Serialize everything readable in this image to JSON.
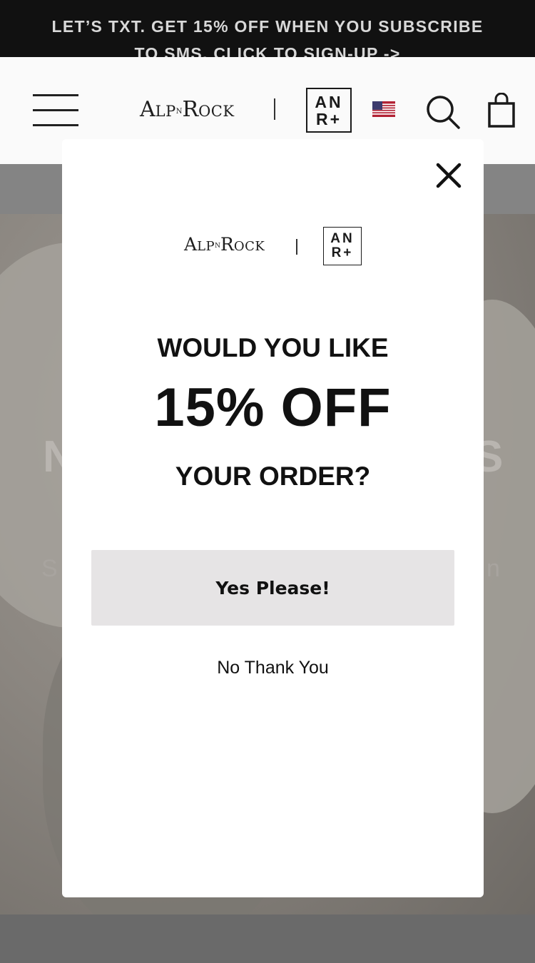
{
  "announcement": {
    "line1": "LET’S TXT. GET 15% OFF WHEN YOU SUBSCRIBE",
    "line2": "TO SMS. CLICK TO SIGN-UP ->"
  },
  "header": {
    "brand": {
      "first": "A",
      "lp": "LP",
      "n": "N",
      "r": "R",
      "ock": "OCK"
    },
    "sub_brand": {
      "top": "AN",
      "bottom": "R+"
    },
    "icons": [
      "hamburger-menu-icon",
      "us-flag-icon",
      "search-icon",
      "shopping-bag-icon"
    ]
  },
  "hero": {
    "title_left": "N",
    "title_right": "S",
    "sub_left": "S",
    "sub_right": "n"
  },
  "modal": {
    "brand": {
      "first": "A",
      "lp": "LP",
      "n": "N",
      "r": "R",
      "ock": "OCK"
    },
    "sub_brand": {
      "top": "AN",
      "bottom": "R+"
    },
    "headline_top": "WOULD YOU LIKE",
    "headline_offer": "15% OFF",
    "headline_bottom": "YOUR ORDER?",
    "accept_label": "Yes Please!",
    "decline_label": "No Thank You",
    "close_icon": "close-icon"
  },
  "colors": {
    "announcement_bg": "#111111",
    "announcement_text": "#d8d8d8",
    "modal_bg": "#ffffff",
    "button_bg": "#e6e4e5",
    "text": "#111111",
    "overlay": "#6f6f6f"
  }
}
